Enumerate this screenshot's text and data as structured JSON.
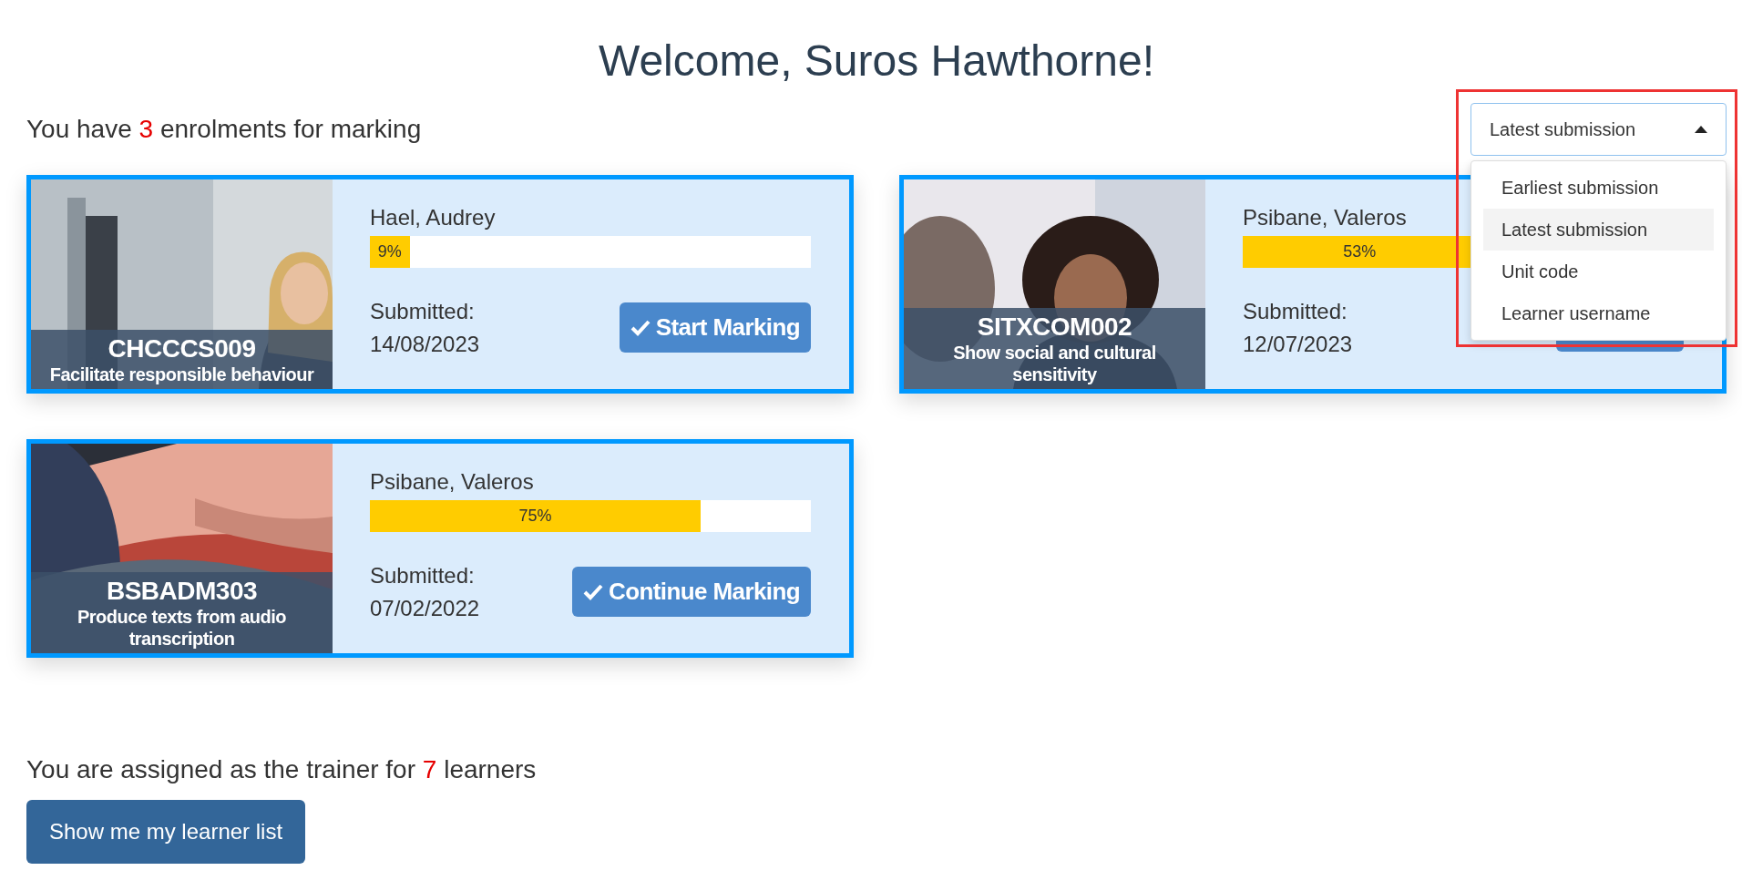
{
  "heading": "Welcome, Suros Hawthorne!",
  "enrolment_summary": {
    "before": "You have ",
    "count": "3",
    "after": " enrolments for marking"
  },
  "sort": {
    "value": "Latest submission",
    "expanded": true,
    "highlighted": true,
    "options": [
      {
        "label": "Earliest submission",
        "selected": false
      },
      {
        "label": "Latest submission",
        "selected": true
      },
      {
        "label": "Unit code",
        "selected": false
      },
      {
        "label": "Learner username",
        "selected": false
      }
    ]
  },
  "cards": [
    {
      "unit_code": "CHCCCS009",
      "unit_title": "Facilitate responsible behaviour",
      "learner": "Hael, Audrey",
      "level": 0.09,
      "progress_label": "9%",
      "submitted_label": "Submitted:",
      "submitted_date": "14/08/2023",
      "button": "Start Marking"
    },
    {
      "unit_code": "SITXCOM002",
      "unit_title": "Show social and cultural sensitivity",
      "learner": "Psibane, Valeros",
      "level": 0.53,
      "progress_label": "53%",
      "submitted_label": "Submitted:",
      "submitted_date": "12/07/2023"
    },
    {
      "unit_code": "BSBADM303",
      "unit_title": "Produce texts from audio transcription",
      "learner": "Psibane, Valeros",
      "level": 0.75,
      "progress_label": "75%",
      "submitted_label": "Submitted:",
      "submitted_date": "07/02/2022",
      "button": "Continue Marking"
    }
  ],
  "trainer_summary": {
    "before": "You are assigned as the trainer for ",
    "count": "7",
    "after": " learners"
  },
  "learner_list_button": "Show me my learner list"
}
